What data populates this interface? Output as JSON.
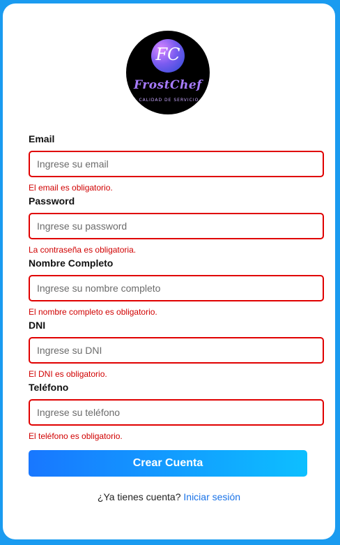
{
  "brand": {
    "monogram": "FC",
    "name": "FrostChef",
    "tagline": "LA CALIDAD DE SERVICIO"
  },
  "fields": [
    {
      "label": "Email",
      "placeholder": "Ingrese su email",
      "value": "",
      "error": "El email es obligatorio."
    },
    {
      "label": "Password",
      "placeholder": "Ingrese su password",
      "value": "",
      "error": "La contraseña es obligatoria."
    },
    {
      "label": "Nombre Completo",
      "placeholder": "Ingrese su nombre completo",
      "value": "",
      "error": "El nombre completo es obligatorio."
    },
    {
      "label": "DNI",
      "placeholder": "Ingrese su DNI",
      "value": "",
      "error": "El DNI es obligatorio."
    },
    {
      "label": "Teléfono",
      "placeholder": "Ingrese su teléfono",
      "value": "",
      "error": "El teléfono es obligatorio."
    }
  ],
  "submit_label": "Crear Cuenta",
  "footer": {
    "prompt": "¿Ya tienes cuenta?",
    "link_label": "Iniciar sesión"
  },
  "colors": {
    "background": "#1a9bf0",
    "error": "#d00000",
    "button_start": "#1877ff",
    "button_end": "#0dbfff",
    "link": "#1a73e8"
  }
}
